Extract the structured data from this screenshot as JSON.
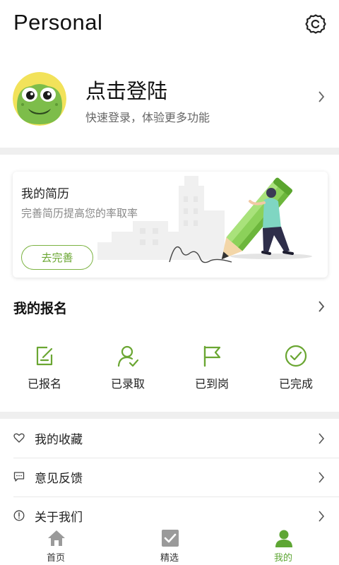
{
  "header": {
    "title": "Personal",
    "settings_icon": "settings-gear-icon"
  },
  "profile": {
    "login_title": "点击登陆",
    "login_subtitle": "快速登录，体验更多功能"
  },
  "resume_card": {
    "title": "我的简历",
    "subtitle": "完善简历提高您的率取率",
    "button_label": "去完善"
  },
  "registration": {
    "title": "我的报名",
    "statuses": [
      {
        "label": "已报名",
        "icon": "edit-form-icon"
      },
      {
        "label": "已录取",
        "icon": "user-check-icon"
      },
      {
        "label": "已到岗",
        "icon": "flag-icon"
      },
      {
        "label": "已完成",
        "icon": "check-circle-icon"
      }
    ]
  },
  "menu": [
    {
      "label": "我的收藏",
      "icon": "heart-icon"
    },
    {
      "label": "意见反馈",
      "icon": "feedback-icon"
    },
    {
      "label": "关于我们",
      "icon": "info-icon"
    }
  ],
  "tabbar": {
    "tabs": [
      {
        "label": "首页",
        "icon": "home-icon"
      },
      {
        "label": "精选",
        "icon": "featured-check-icon"
      },
      {
        "label": "我的",
        "icon": "user-icon"
      }
    ],
    "active_index": 2
  },
  "colors": {
    "accent": "#5ea634",
    "accent_light": "#8cc63f",
    "divider": "#efefef"
  }
}
